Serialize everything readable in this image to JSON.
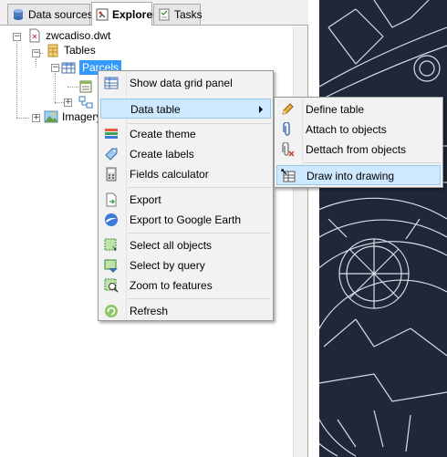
{
  "tabs": [
    {
      "label": "Data sources",
      "icon": "database-icon"
    },
    {
      "label": "Explorer",
      "icon": "explorer-icon"
    },
    {
      "label": "Tasks",
      "icon": "tasks-icon"
    }
  ],
  "tree": {
    "root": "zwcadiso.dwt",
    "tables": "Tables",
    "parcels": "Parcels",
    "imagery": "Imagery"
  },
  "context_menu": {
    "items": [
      {
        "label": "Show data grid panel",
        "icon": "grid-panel-icon"
      },
      {
        "label": "Data table",
        "icon": "",
        "submenu": true
      },
      {
        "label": "Create theme",
        "icon": "theme-icon"
      },
      {
        "label": "Create labels",
        "icon": "labels-icon"
      },
      {
        "label": "Fields calculator",
        "icon": "calculator-icon"
      },
      {
        "label": "Export",
        "icon": "export-icon"
      },
      {
        "label": "Export to Google Earth",
        "icon": "google-earth-icon"
      },
      {
        "label": "Select all objects",
        "icon": "select-all-icon"
      },
      {
        "label": "Select by query",
        "icon": "select-query-icon"
      },
      {
        "label": "Zoom to features",
        "icon": "zoom-features-icon"
      },
      {
        "label": "Refresh",
        "icon": "refresh-icon"
      }
    ]
  },
  "submenu": {
    "items": [
      {
        "label": "Define table",
        "icon": "pencil-icon"
      },
      {
        "label": "Attach to objects",
        "icon": "paperclip-icon"
      },
      {
        "label": "Dettach from objects",
        "icon": "detach-icon"
      },
      {
        "label": "Draw into drawing",
        "icon": "draw-table-icon"
      }
    ]
  },
  "colors": {
    "selection": "#3399ff",
    "menu_highlight": "#cde8ff",
    "cad_background": "#1e2838",
    "cad_lines": "#d8dde6"
  }
}
